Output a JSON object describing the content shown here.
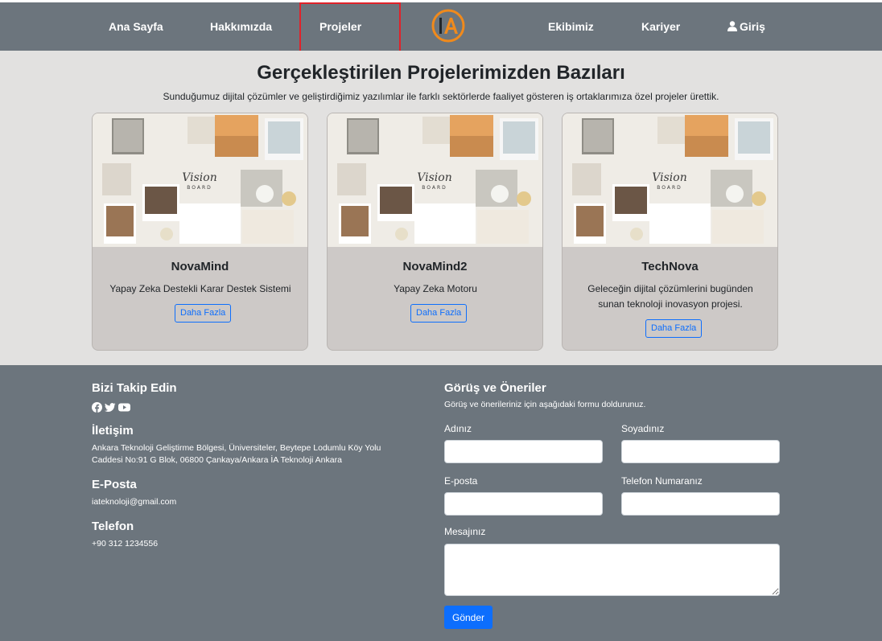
{
  "nav": {
    "home": "Ana Sayfa",
    "about": "Hakkımızda",
    "projects": "Projeler",
    "logo_text": "IA",
    "team": "Ekibimiz",
    "career": "Kariyer",
    "login": "Giriş"
  },
  "projects": {
    "title": "Gerçekleştirilen Projelerimizden Bazıları",
    "subtitle": "Sunduğumuz dijital çözümler ve geliştirdiğimiz yazılımlar ile farklı sektörlerde faaliyet gösteren iş ortaklarımıza özel projeler ürettik.",
    "image_text": {
      "vision": "Vision",
      "board": "BOARD"
    },
    "cards": [
      {
        "title": "NovaMind",
        "description": "Yapay Zeka Destekli Karar Destek Sistemi",
        "button": "Daha Fazla"
      },
      {
        "title": "NovaMind2",
        "description": "Yapay Zeka Motoru",
        "button": "Daha Fazla"
      },
      {
        "title": "TechNova",
        "description": "Geleceğin dijital çözümlerini bugünden sunan teknoloji inovasyon projesi.",
        "button": "Daha Fazla"
      }
    ]
  },
  "footer": {
    "follow_title": "Bizi Takip Edin",
    "social_icons": [
      "facebook-icon",
      "twitter-icon",
      "youtube-icon"
    ],
    "contact_title": "İletişim",
    "address": "Ankara Teknoloji Geliştirme Bölgesi, Üniversiteler, Beytepe Lodumlu Köy Yolu Caddesi No:91 G Blok, 06800 Çankaya/Ankara İA Teknoloji Ankara",
    "email_title": "E-Posta",
    "email": "iateknoloji@gmail.com",
    "phone_title": "Telefon",
    "phone": "+90 312 1234556"
  },
  "form": {
    "title": "Görüş ve Öneriler",
    "subtitle": "Görüş ve önerileriniz için aşağıdaki formu doldurunuz.",
    "first_name_label": "Adınız",
    "last_name_label": "Soyadınız",
    "email_label": "E-posta",
    "phone_label": "Telefon Numaranız",
    "message_label": "Mesajınız",
    "submit": "Gönder"
  },
  "colors": {
    "navbar": "#6c757d",
    "section_bg": "#e2e1e0",
    "card_bg": "#cdc9c7",
    "accent": "#0d6efd",
    "logo_orange": "#f08a1c",
    "highlight": "#e0222a"
  }
}
